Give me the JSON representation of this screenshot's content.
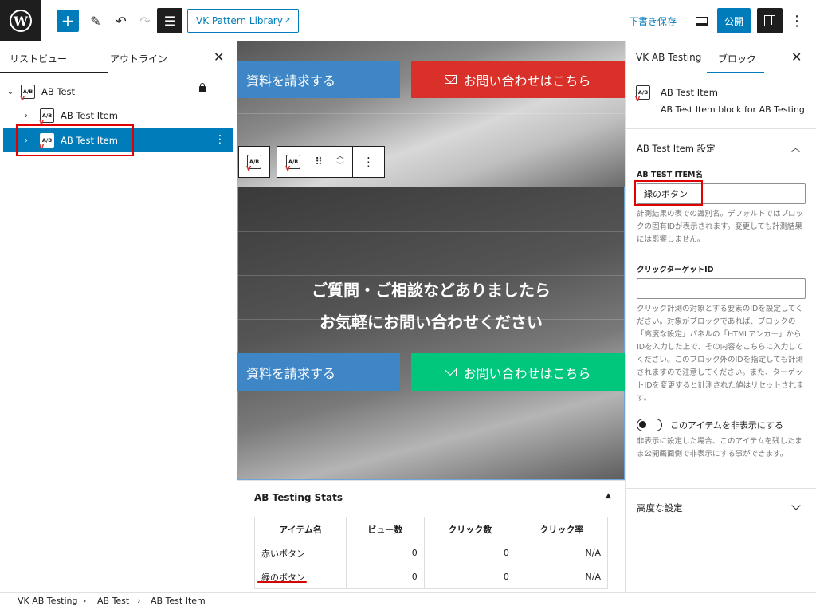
{
  "topbar": {
    "pattern_library": "VK Pattern Library",
    "save_draft": "下書き保存",
    "publish": "公開"
  },
  "left_panel": {
    "tab_list": "リストビュー",
    "tab_outline": "アウトライン",
    "tree": [
      {
        "label": "AB Test"
      },
      {
        "label": "AB Test Item"
      },
      {
        "label": "AB Test Item"
      }
    ]
  },
  "canvas": {
    "button_request": "資料を請求する",
    "button_contact": "お問い合わせはこちら",
    "hero_line1": "ご質問・ご相談などありましたら",
    "hero_line2": "お気軽にお問い合わせください",
    "colors": {
      "red": "#d9302a",
      "green": "#00c77c",
      "blue": "#3f86c6"
    }
  },
  "stats": {
    "title": "AB Testing Stats",
    "headers": [
      "アイテム名",
      "ビュー数",
      "クリック数",
      "クリック率"
    ],
    "rows": [
      [
        "赤いボタン",
        "0",
        "0",
        "N/A"
      ],
      [
        "緑のボタン",
        "0",
        "0",
        "N/A"
      ]
    ]
  },
  "right_panel": {
    "tab_ab": "VK AB Testing",
    "tab_block": "ブロック",
    "block_name": "AB Test Item",
    "block_desc": "AB Test Item block for AB Testing",
    "settings_title": "AB Test Item 設定",
    "item_name_label": "AB TEST ITEM名",
    "item_name_value": "緑のボタン",
    "item_name_help": "計測結果の表での識別名。デフォルトではブロックの固有IDが表示されます。変更しても計測結果には影響しません。",
    "target_label": "クリックターゲットID",
    "target_value": "",
    "target_help": "クリック計測の対象とする要素のIDを設定してください。対象がブロックであれば、ブロックの「高度な設定」パネルの「HTMLアンカー」からIDを入力した上で、その内容をこちらに入力してください。このブロック外のIDを指定しても計測されますので注意してください。また、ターゲットIDを変更すると計測された値はリセットされます。",
    "hide_label": "このアイテムを非表示にする",
    "hide_help": "非表示に設定した場合、このアイテムを残したまま公開画面側で非表示にする事ができます。",
    "advanced": "高度な設定"
  },
  "breadcrumb": [
    "VK AB Testing",
    "AB Test",
    "AB Test Item"
  ],
  "icons": {
    "ab_icon_text": "A/B"
  }
}
